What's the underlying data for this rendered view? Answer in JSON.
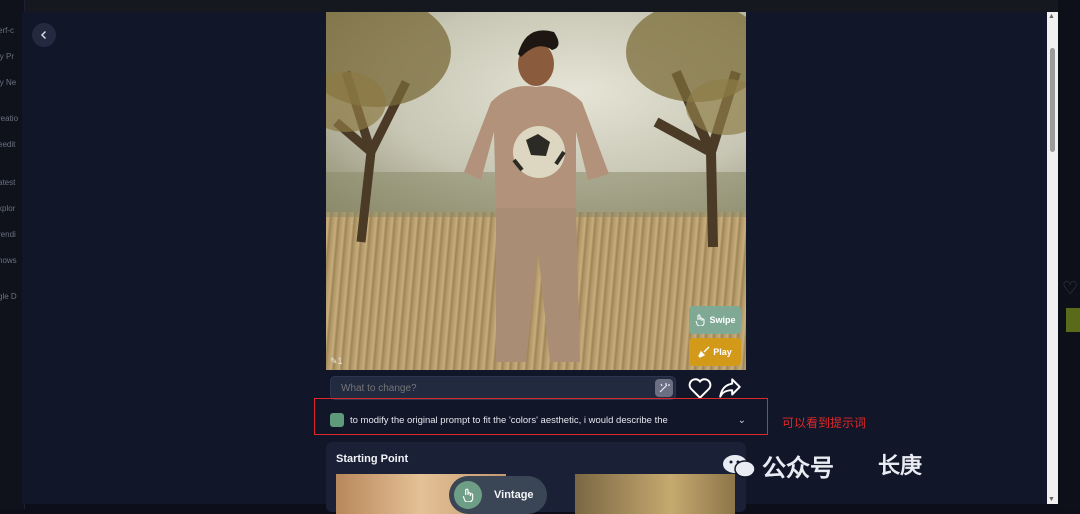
{
  "background_app": {
    "sidebar_items": [
      "erf-c",
      "ly Pr",
      "ly Ne",
      "reatio",
      "eedit",
      "atest",
      "xplor",
      "rendi",
      "hows",
      "gle D"
    ]
  },
  "viewer": {
    "back_icon": "chevron-left-icon",
    "image_alt": "Man in beige sweatsuit holding a soccer ball in a dry grass field with trees",
    "count_badge": "1",
    "swipe_label": "Swipe",
    "play_label": "Play"
  },
  "edit": {
    "placeholder": "What to change?"
  },
  "prompt": {
    "text": "to modify the original prompt to fit the 'colors' aesthetic, i would describe the"
  },
  "annotation": {
    "text": "可以看到提示词",
    "color": "#e02828"
  },
  "starting_point": {
    "title": "Starting Point",
    "chip_label": "Vintage"
  },
  "watermark": {
    "text": "公众号",
    "suffix": "长庚"
  },
  "colors": {
    "modal_bg": "#111628",
    "swipe_bg": "#7fa995",
    "play_bg": "#d39a1a",
    "card_bg": "#1a2035"
  }
}
